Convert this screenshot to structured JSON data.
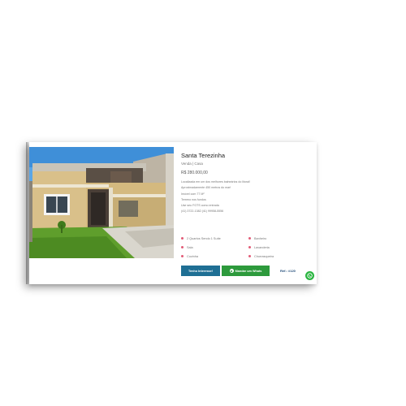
{
  "listing": {
    "title": "Santa Terezinha",
    "subtitle": "Venda | Casa",
    "price": "R$ 280.000,00",
    "description": [
      "Localizada em um dos melhores balneários do litoral!",
      "Aproximadamente 450 metros do mar!",
      "Imóvel com 77 M²",
      "Terreno nos fundos",
      "Use seu FGTS como entrada",
      "(41) 3722-1382 (41) 99958-5556"
    ],
    "features": [
      "2 Quartos Sendo 1 Suíte",
      "Banheiro",
      "Sala",
      "Lavanderia",
      "Cozinha",
      "Churrasqueira"
    ],
    "interest_button": "Tenho Interesse!",
    "whatsapp_button": "Mandar um Whats",
    "ref": "Ref.: #120",
    "watermark": "Berger"
  },
  "colors": {
    "primary": "#1f6f94",
    "whatsapp": "#2d9a3c",
    "feature_dot": "#e25c77"
  },
  "icons": {
    "feature": "pink-dot-icon",
    "whatsapp": "whatsapp-icon"
  }
}
